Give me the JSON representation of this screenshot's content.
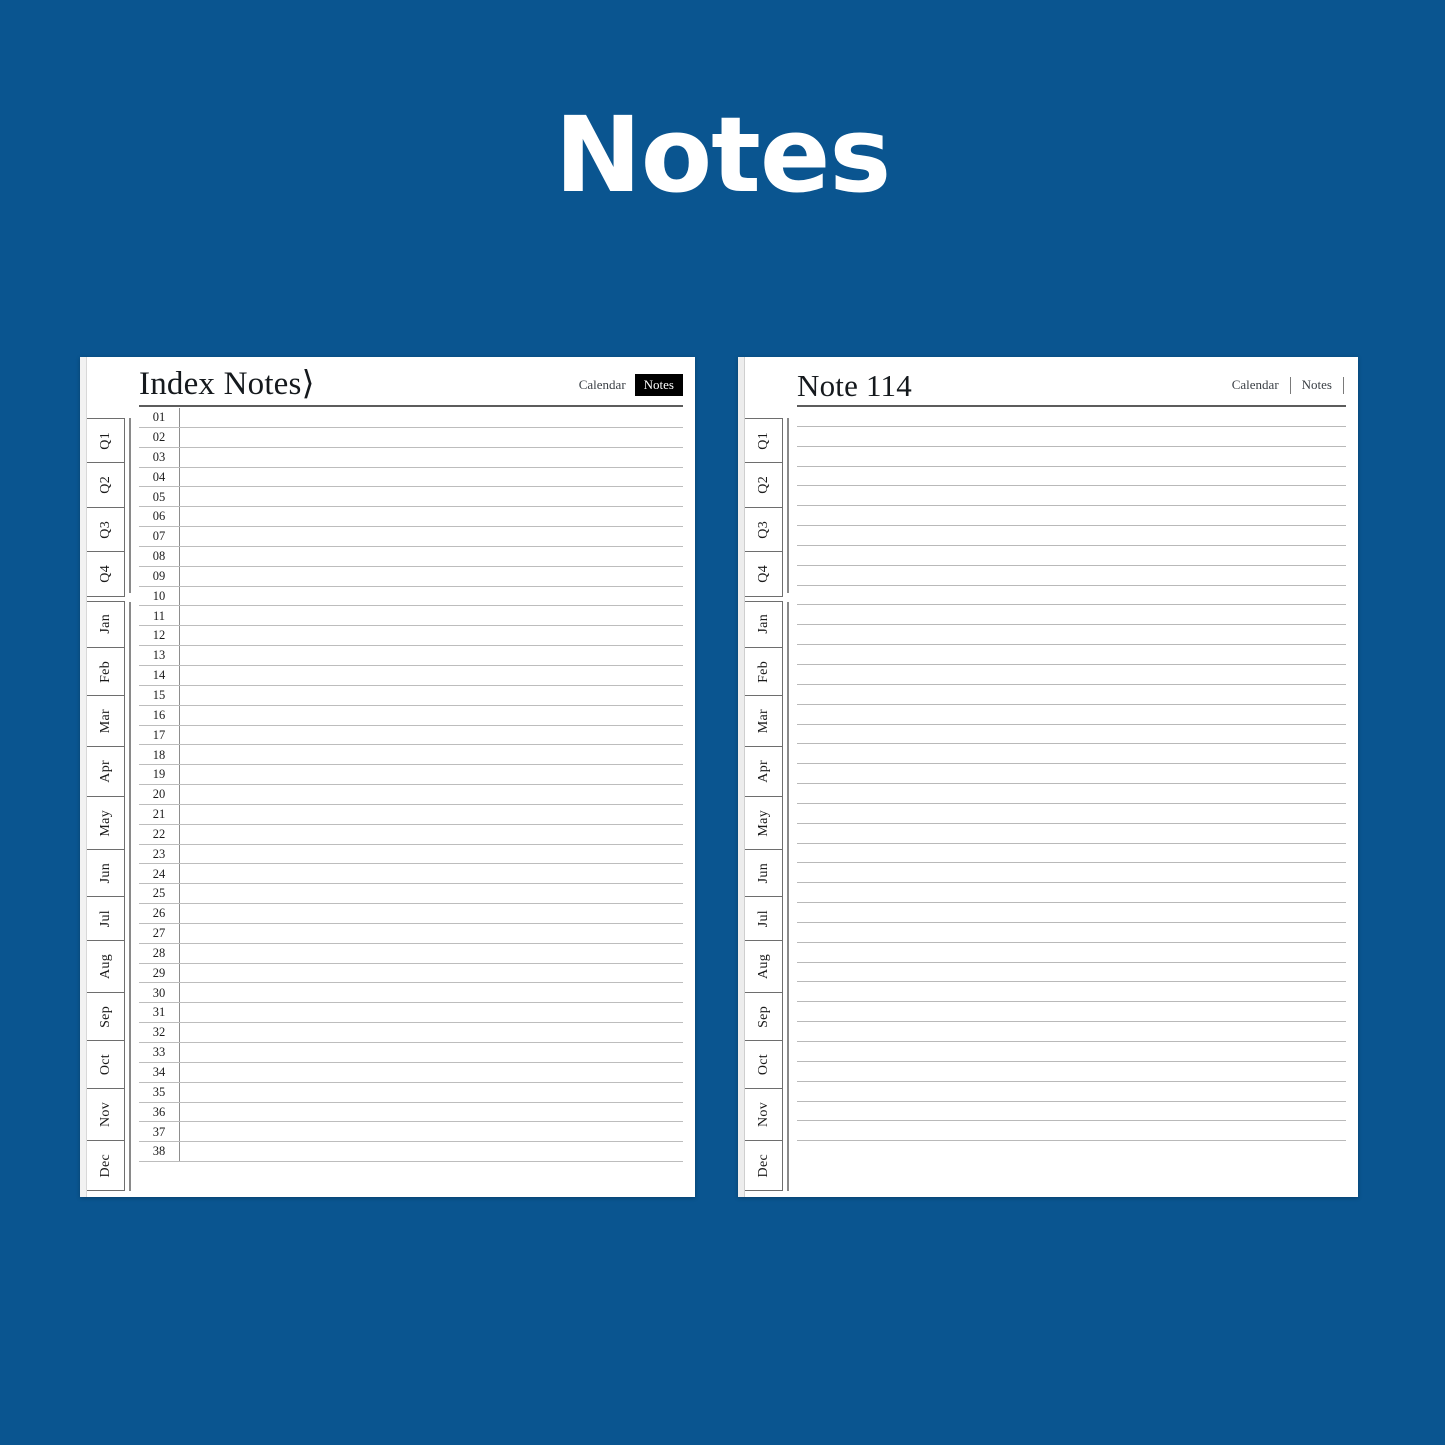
{
  "banner": {
    "title": "Notes",
    "background_color": "#0a5590",
    "text_color": "#ffffff"
  },
  "tab_rail": {
    "quarters": [
      {
        "label": "Q1"
      },
      {
        "label": "Q2"
      },
      {
        "label": "Q3"
      },
      {
        "label": "Q4"
      }
    ],
    "months": [
      {
        "label": "Jan"
      },
      {
        "label": "Feb"
      },
      {
        "label": "Mar"
      },
      {
        "label": "Apr"
      },
      {
        "label": "May"
      },
      {
        "label": "Jun"
      },
      {
        "label": "Jul"
      },
      {
        "label": "Aug"
      },
      {
        "label": "Sep"
      },
      {
        "label": "Oct"
      },
      {
        "label": "Nov"
      },
      {
        "label": "Dec"
      }
    ]
  },
  "left_page": {
    "title": "Index Notes⟩",
    "header_tabs": [
      {
        "label": "Calendar",
        "active": false
      },
      {
        "label": "Notes",
        "active": true
      }
    ],
    "row_numbers": [
      "01",
      "02",
      "03",
      "04",
      "05",
      "06",
      "07",
      "08",
      "09",
      "10",
      "11",
      "12",
      "13",
      "14",
      "15",
      "16",
      "17",
      "18",
      "19",
      "20",
      "21",
      "22",
      "23",
      "24",
      "25",
      "26",
      "27",
      "28",
      "29",
      "30",
      "31",
      "32",
      "33",
      "34",
      "35",
      "36",
      "37",
      "38"
    ]
  },
  "right_page": {
    "title": "Note 114",
    "header_tabs": [
      {
        "label": "Calendar",
        "active": false
      },
      {
        "label": "Notes",
        "active": false
      }
    ],
    "ruled_line_count": 37
  }
}
